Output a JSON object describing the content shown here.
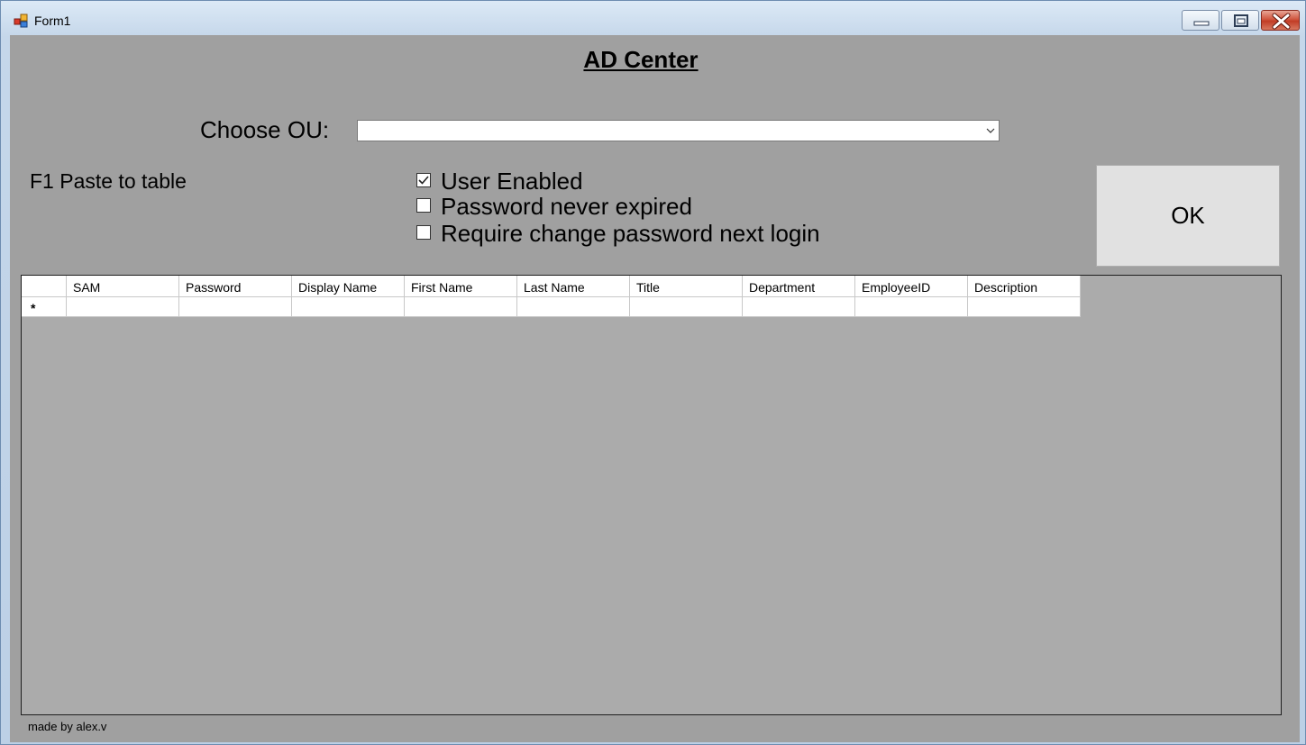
{
  "window": {
    "title": "Form1",
    "icon": "app-form-icon",
    "controls": [
      "minimize-icon",
      "maximize-icon",
      "close-icon"
    ]
  },
  "app_title": "AD Center",
  "ou": {
    "label": "Choose OU:",
    "selected": ""
  },
  "paste_hint": "F1 Paste to table",
  "options": [
    {
      "label": "User Enabled",
      "checked": true
    },
    {
      "label": "Password never expired",
      "checked": false
    },
    {
      "label": "Require change password next login",
      "checked": false
    }
  ],
  "ok_button": "OK",
  "grid": {
    "columns": [
      "SAM",
      "Password",
      "Display Name",
      "First Name",
      "Last Name",
      "Title",
      "Department",
      "EmployeeID",
      "Description"
    ],
    "new_row_marker": "*"
  },
  "footer": "made by alex.v",
  "colors": {
    "form_background": "#a0a0a0",
    "grid_background": "#ababab",
    "button_background": "#e1e1e1"
  }
}
